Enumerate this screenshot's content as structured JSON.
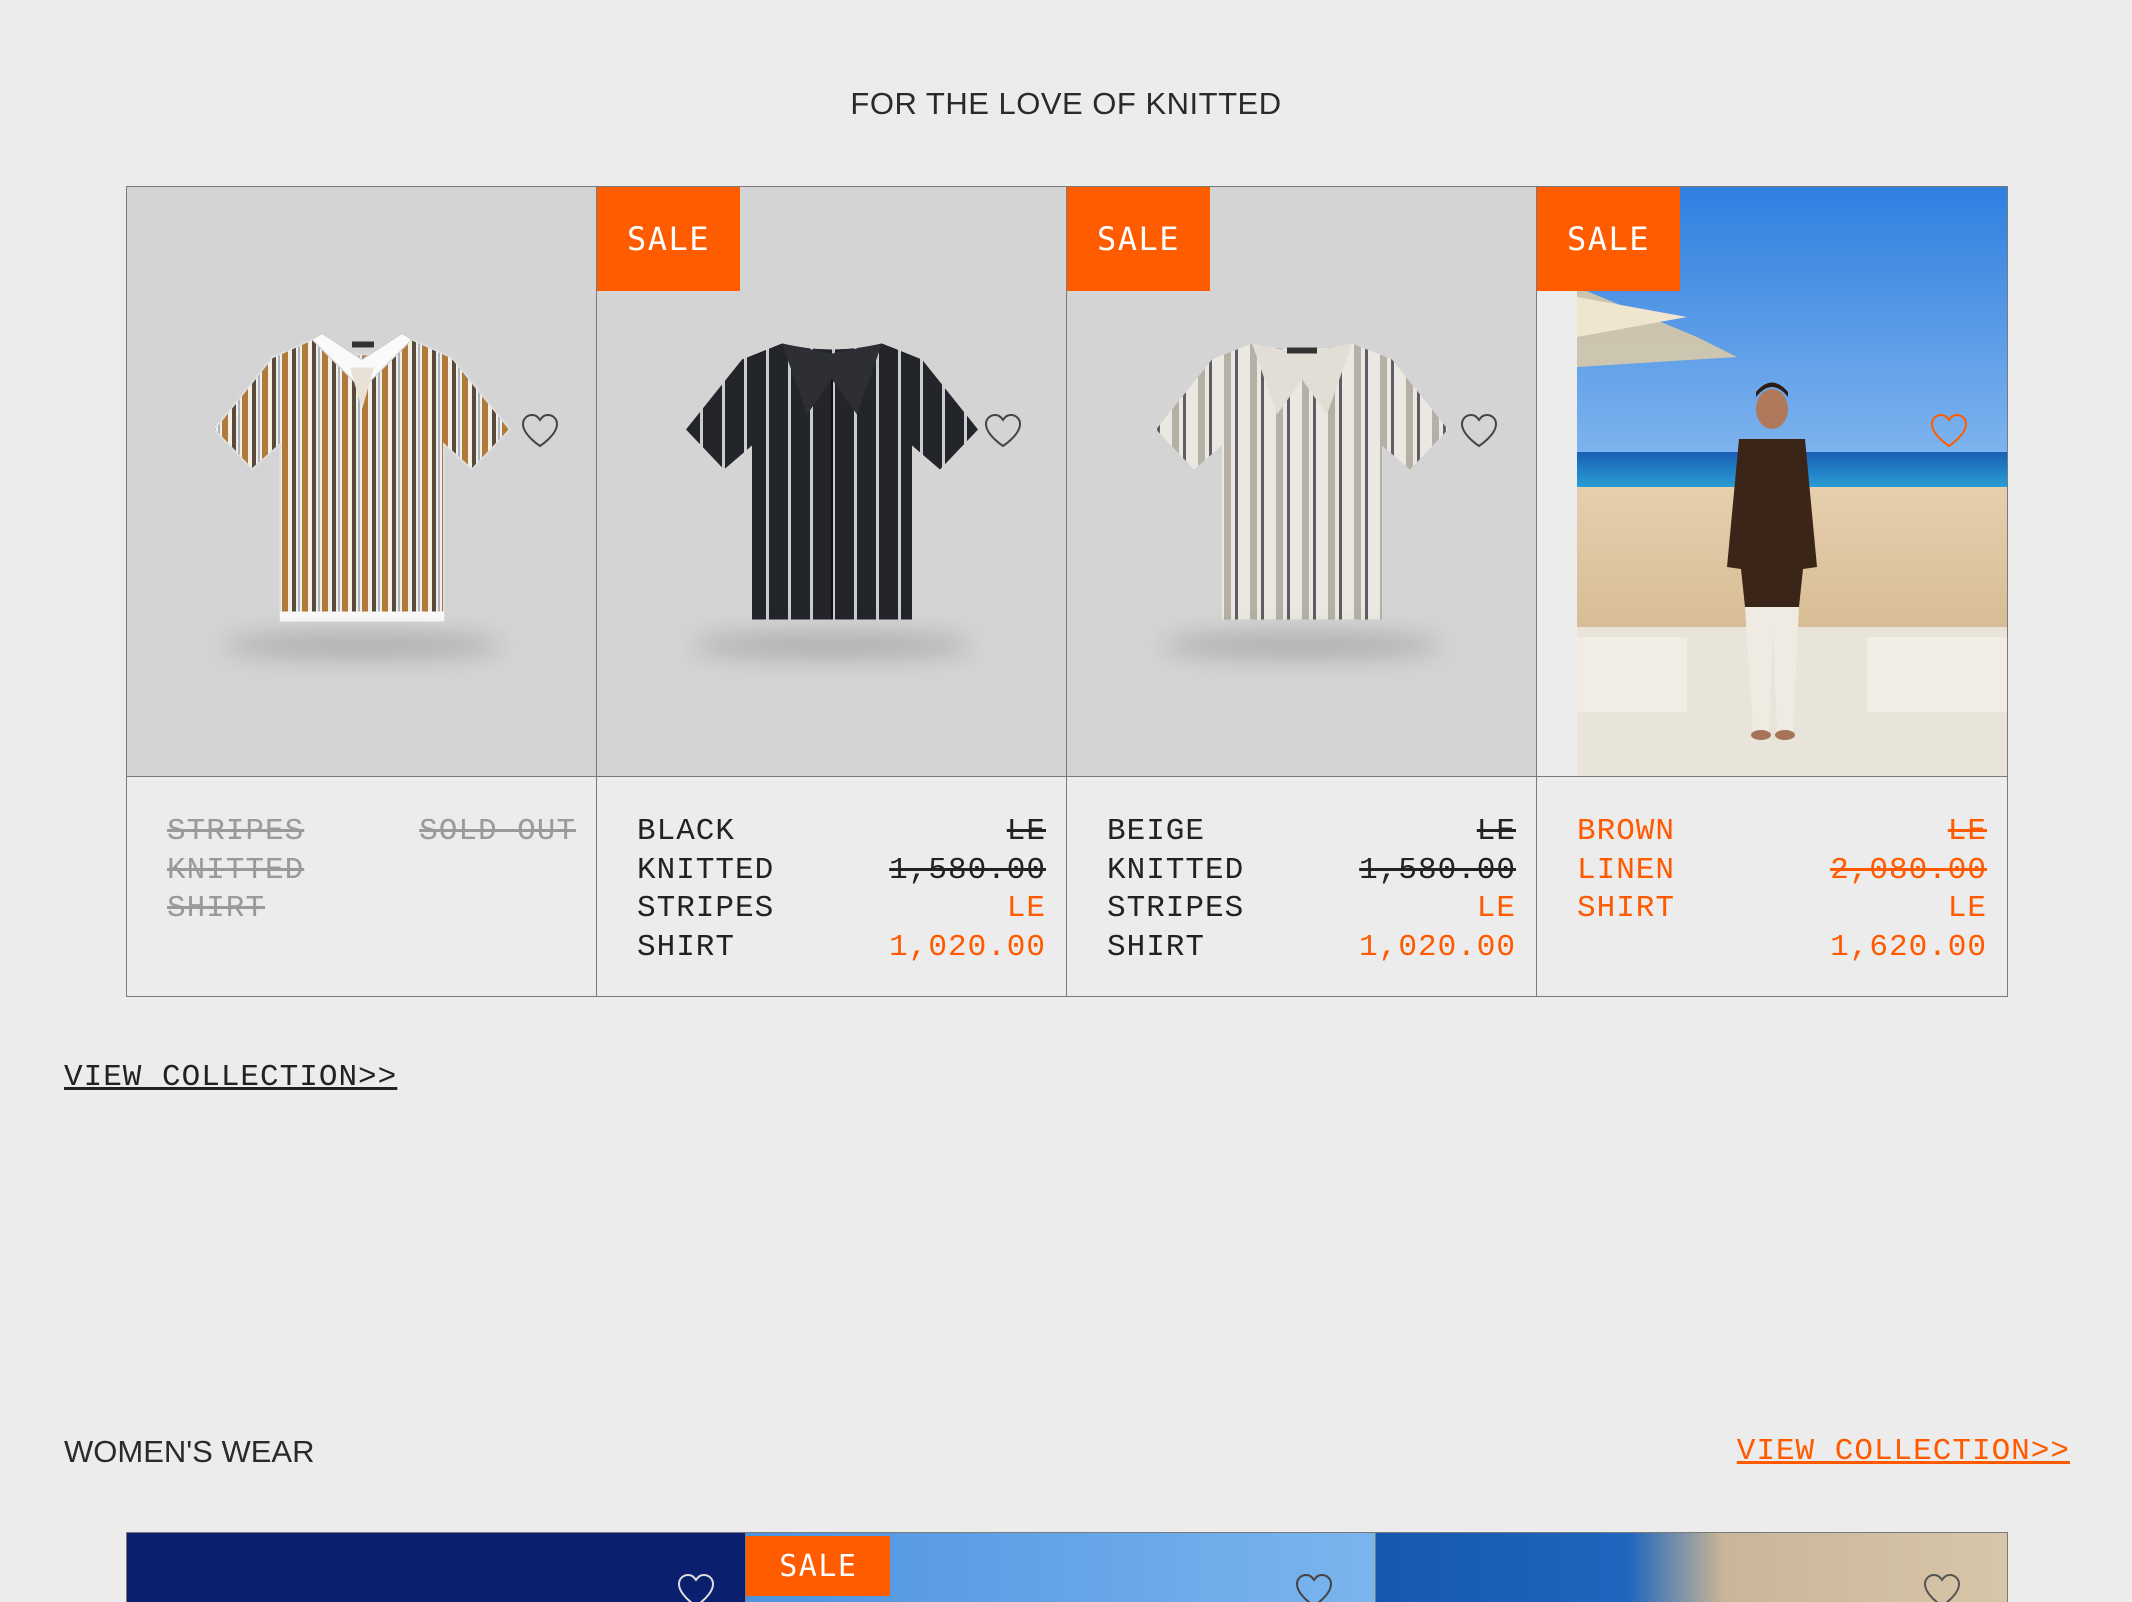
{
  "section1": {
    "title": "FOR THE LOVE OF KNITTED",
    "view_link": "VIEW COLLECTION>>",
    "products": [
      {
        "name": "STRIPES KNITTED SHIRT",
        "status": "SOLD OUT"
      },
      {
        "badge": "SALE",
        "name": "BLACK KNITTED STRIPES SHIRT",
        "old_price": "LE 1,580.00",
        "new_price": "LE 1,020.00"
      },
      {
        "badge": "SALE",
        "name": "BEIGE KNITTED STRIPES SHIRT",
        "old_price": "LE 1,580.00",
        "new_price": "LE 1,020.00"
      },
      {
        "badge": "SALE",
        "name": "BROWN LINEN SHIRT",
        "old_price": "LE 2,080.00",
        "new_price": "LE 1,620.00"
      }
    ]
  },
  "section2": {
    "title": "WOMEN'S WEAR",
    "view_link": "VIEW COLLECTION>>",
    "badge": "SALE"
  },
  "colors": {
    "accent": "#ff5c00",
    "background": "#ececec",
    "card_image": "#d4d4d4",
    "border": "#7a7a7a"
  },
  "icons": [
    "heart-icon"
  ]
}
